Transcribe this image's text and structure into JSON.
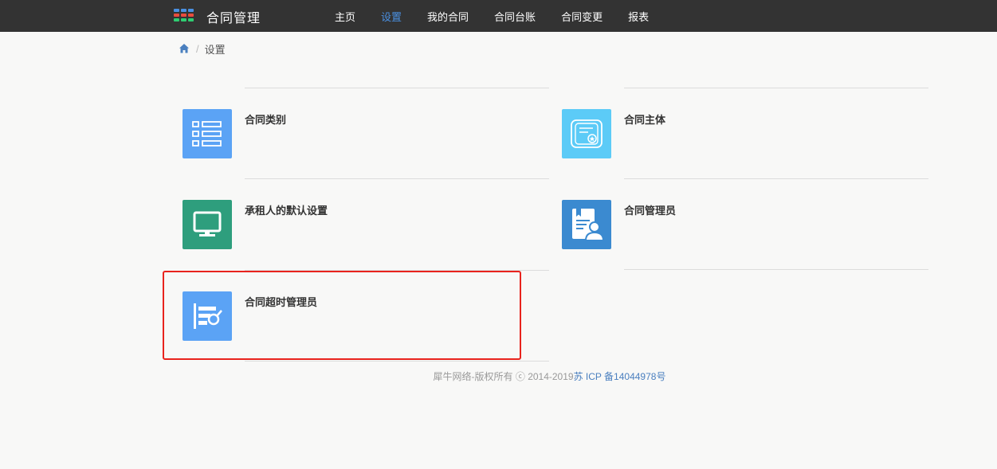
{
  "header": {
    "app_title": "合同管理",
    "nav": [
      {
        "label": "主页",
        "active": false
      },
      {
        "label": "设置",
        "active": true
      },
      {
        "label": "我的合同",
        "active": false
      },
      {
        "label": "合同台账",
        "active": false
      },
      {
        "label": "合同变更",
        "active": false
      },
      {
        "label": "报表",
        "active": false
      }
    ]
  },
  "breadcrumb": {
    "home_icon": "home-icon",
    "current": "设置"
  },
  "settings": [
    {
      "label": "合同类别",
      "icon": "list-icon",
      "color": "#5ba3f5"
    },
    {
      "label": "合同主体",
      "icon": "certificate-icon",
      "color": "#5ccbf7"
    },
    {
      "label": "承租人的默认设置",
      "icon": "monitor-icon",
      "color": "#2e9e7d"
    },
    {
      "label": "合同管理员",
      "icon": "admin-document-icon",
      "color": "#3b8ad0"
    },
    {
      "label": "合同超时管理员",
      "icon": "timeout-search-icon",
      "color": "#5ba3f5"
    }
  ],
  "footer": {
    "copyright": "犀牛网络-版权所有 ⓒ 2014-2019",
    "icp": "苏 ICP 备14044978号"
  },
  "colors": {
    "topbar": "#333333",
    "active_nav": "#4a90e2",
    "highlight": "#e8231d"
  }
}
